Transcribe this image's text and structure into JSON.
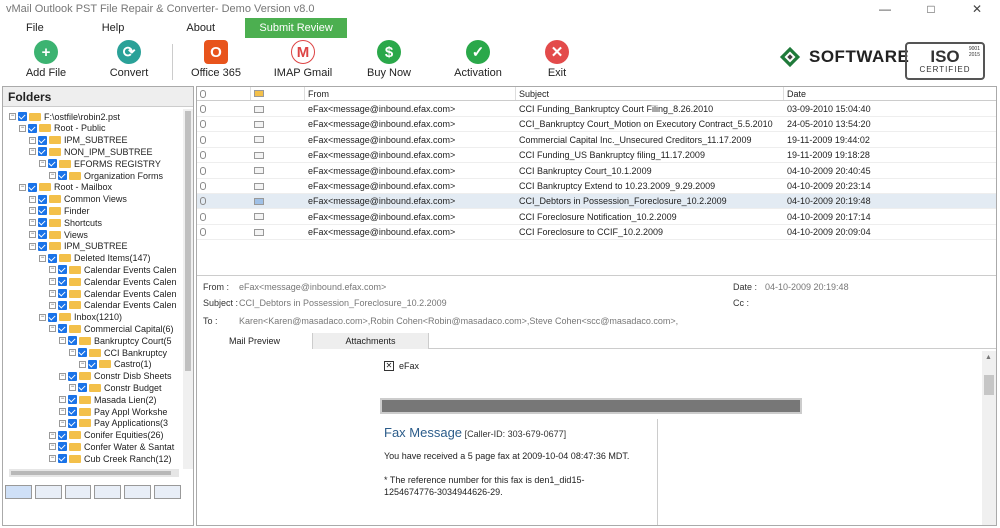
{
  "window": {
    "title": "vMail Outlook PST File Repair & Converter- Demo Version v8.0",
    "minimize": "—",
    "maximize": "□",
    "close": "✕"
  },
  "menu": {
    "file": "File",
    "help": "Help",
    "about": "About",
    "submit": "Submit Review"
  },
  "toolbar": {
    "add_file": "Add File",
    "convert": "Convert",
    "office365": "Office 365",
    "imap": "IMAP Gmail",
    "buy": "Buy Now",
    "activation": "Activation",
    "exit": "Exit"
  },
  "brand": {
    "name": "SOFTWARE",
    "iso": "ISO",
    "iso_sub": "CERTIFIED",
    "iso_num1": "9001",
    "iso_num2": "2015"
  },
  "colors": {
    "add": "#3cb371",
    "convert": "#2aa198",
    "office": "#e8541c",
    "imap": "#ffffff",
    "buy": "#2aa84a",
    "activation": "#2aa84a",
    "exit": "#e34b4b",
    "accent": "#1a73e8"
  },
  "folders": {
    "title": "Folders",
    "items": [
      {
        "label": "F:\\ostfile\\robin2.pst",
        "level": 0
      },
      {
        "label": "Root - Public",
        "level": 1
      },
      {
        "label": "IPM_SUBTREE",
        "level": 2
      },
      {
        "label": "NON_IPM_SUBTREE",
        "level": 2
      },
      {
        "label": "EFORMS REGISTRY",
        "level": 3
      },
      {
        "label": "Organization Forms",
        "level": 4
      },
      {
        "label": "Root - Mailbox",
        "level": 1
      },
      {
        "label": "Common Views",
        "level": 2
      },
      {
        "label": "Finder",
        "level": 2
      },
      {
        "label": "Shortcuts",
        "level": 2
      },
      {
        "label": "Views",
        "level": 2
      },
      {
        "label": "IPM_SUBTREE",
        "level": 2
      },
      {
        "label": "Deleted Items(147)",
        "level": 3
      },
      {
        "label": "Calendar Events Calen",
        "level": 4
      },
      {
        "label": "Calendar Events Calen",
        "level": 4
      },
      {
        "label": "Calendar Events Calen",
        "level": 4
      },
      {
        "label": "Calendar Events Calen",
        "level": 4
      },
      {
        "label": "Inbox(1210)",
        "level": 3
      },
      {
        "label": "Commercial Capital(6)",
        "level": 4
      },
      {
        "label": "Bankruptcy Court(5",
        "level": 5
      },
      {
        "label": "CCI Bankruptcy",
        "level": 6
      },
      {
        "label": "Castro(1)",
        "level": 7
      },
      {
        "label": "Constr Disb Sheets",
        "level": 5
      },
      {
        "label": "Constr Budget",
        "level": 6
      },
      {
        "label": "Masada Lien(2)",
        "level": 5
      },
      {
        "label": "Pay Appl Workshe",
        "level": 5
      },
      {
        "label": "Pay Applications(3",
        "level": 5
      },
      {
        "label": "Conifer Equities(26)",
        "level": 4
      },
      {
        "label": "Confer Water & Santat",
        "level": 4
      },
      {
        "label": "Cub Creek Ranch(12)",
        "level": 4
      }
    ]
  },
  "grid": {
    "headers": {
      "from": "From",
      "subject": "Subject",
      "date": "Date"
    },
    "rows": [
      {
        "from": "eFax<message@inbound.efax.com>",
        "subject": "CCI Funding_Bankruptcy Court Filing_8.26.2010",
        "date": "03-09-2010 15:04:40"
      },
      {
        "from": "eFax<message@inbound.efax.com>",
        "subject": "CCI_Bankruptcy Court_Motion on Executory Contract_5.5.2010",
        "date": "24-05-2010 13:54:20"
      },
      {
        "from": "eFax<message@inbound.efax.com>",
        "subject": "Commercial Capital Inc._Unsecured Creditors_11.17.2009",
        "date": "19-11-2009 19:44:02"
      },
      {
        "from": "eFax<message@inbound.efax.com>",
        "subject": "CCI Funding_US Bankruptcy filing_11.17.2009",
        "date": "19-11-2009 19:18:28"
      },
      {
        "from": "eFax<message@inbound.efax.com>",
        "subject": "CCI Bankruptcy Court_10.1.2009",
        "date": "04-10-2009 20:40:45"
      },
      {
        "from": "eFax<message@inbound.efax.com>",
        "subject": "CCI Bankruptcy Extend to 10.23.2009_9.29.2009",
        "date": "04-10-2009 20:23:14"
      },
      {
        "from": "eFax<message@inbound.efax.com>",
        "subject": "CCI_Debtors in Possession_Foreclosure_10.2.2009",
        "date": "04-10-2009 20:19:48"
      },
      {
        "from": "eFax<message@inbound.efax.com>",
        "subject": "CCI Foreclosure Notification_10.2.2009",
        "date": "04-10-2009 20:17:14"
      },
      {
        "from": "eFax<message@inbound.efax.com>",
        "subject": "CCI Foreclosure to CCIF_10.2.2009",
        "date": "04-10-2009 20:09:04"
      }
    ],
    "selected_index": 6
  },
  "detail": {
    "from_label": "From :",
    "from": "eFax<message@inbound.efax.com>",
    "subject_label": "Subject :",
    "subject": "CCI_Debtors in Possession_Foreclosure_10.2.2009",
    "to_label": "To :",
    "to": "Karen<Karen@masadaco.com>,Robin Cohen<Robin@masadaco.com>,Steve Cohen<scc@masadaco.com>,",
    "date_label": "Date :",
    "date": "04-10-2009 20:19:48",
    "cc_label": "Cc :"
  },
  "preview_tabs": {
    "mail": "Mail Preview",
    "attachments": "Attachments"
  },
  "preview": {
    "sender": "eFax",
    "fax_title": "Fax Message",
    "caller_id": "[Caller-ID: 303-679-0677]",
    "line1": "You have received a 5 page fax at 2009-10-04 08:47:36 MDT.",
    "line2": "* The reference number for this fax is den1_did15-",
    "line3": "1254674776-3034944626-29."
  }
}
